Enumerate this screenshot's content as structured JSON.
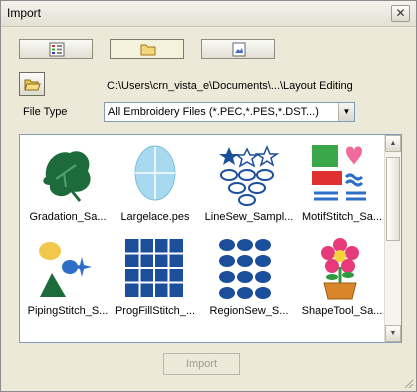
{
  "window": {
    "title": "Import",
    "close_glyph": "✕"
  },
  "toolbar": {
    "tabs": [
      {
        "icon": "list-view-icon"
      },
      {
        "icon": "folder-icon"
      },
      {
        "icon": "document-icon"
      }
    ]
  },
  "path": {
    "open_icon": "open-folder-icon",
    "text": "C:\\Users\\crn_vista_e\\Documents\\...\\Layout Editing"
  },
  "file_type": {
    "label": "File Type",
    "value": "All Embroidery Files (*.PEC,*.PES,*.DST...)"
  },
  "thumbnails": [
    {
      "caption": "Gradation_Sa...",
      "icon": "leaf-icon"
    },
    {
      "caption": "Largelace.pes",
      "icon": "lace-icon"
    },
    {
      "caption": "LineSew_Sampl...",
      "icon": "stars-ovals-icon"
    },
    {
      "caption": "MotifStitch_Sa...",
      "icon": "motif-icon"
    },
    {
      "caption": "PipingStitch_S...",
      "icon": "piping-icon"
    },
    {
      "caption": "ProgFillStitch_...",
      "icon": "grid-icon"
    },
    {
      "caption": "RegionSew_S...",
      "icon": "ovals-grid-icon"
    },
    {
      "caption": "ShapeTool_Sa...",
      "icon": "flower-pot-icon"
    }
  ],
  "scrollbar": {
    "up": "▲",
    "down": "▼"
  },
  "actions": {
    "import_label": "Import"
  }
}
